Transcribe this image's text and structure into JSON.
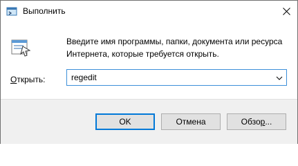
{
  "window": {
    "title": "Выполнить",
    "title_icon": "run-dialog-icon",
    "close_icon": "close-icon"
  },
  "dialog": {
    "icon": "run-program-icon",
    "description_line1": "Введите имя программы, папки, документа или ресурса",
    "description_line2": "Интернета, которые требуется открыть.",
    "open_label_accel": "О",
    "open_label_rest": "ткрыть:",
    "open_value": "regedit",
    "dropdown_icon": "chevron-down-icon"
  },
  "buttons": {
    "ok": "OK",
    "cancel": "Отмена",
    "browse_pre": "Обзо",
    "browse_accel": "р",
    "browse_post": "..."
  },
  "colors": {
    "focus_border": "#0078d7",
    "footer_bg": "#f0f0f0",
    "button_bg": "#e1e1e1"
  }
}
